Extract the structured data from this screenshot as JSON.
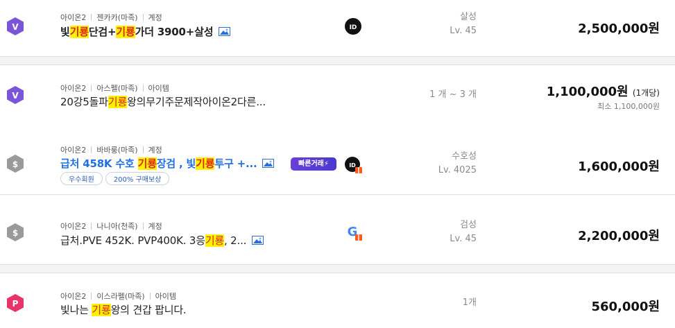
{
  "listings": [
    {
      "grade": "V",
      "grade_color": "#7b55d8",
      "meta": [
        "아이온2",
        "젠카카(마족)",
        "계정"
      ],
      "title_pre": "빛",
      "hl1": "기룡",
      "title_mid": "단검+",
      "hl2": "기룡",
      "title_post": "가더 3900+살성",
      "info_line1": "살성",
      "info_line2": "Lv. 45",
      "price": "2,500,000원",
      "seller_icon": "id-badge-icon"
    },
    {
      "grade": "V",
      "grade_color": "#7b55d8",
      "meta": [
        "아이온2",
        "아스펠(마족)",
        "아이템"
      ],
      "title_pre": "20강5돌파",
      "hl1": "기룡",
      "title_post": "왕의무기주문제작아이온2다른...",
      "info_line1": "1 개 ~ 3 개",
      "price": "1,100,000원",
      "price_unit": "(1개당)",
      "min_price": "최소 1,100,000원"
    },
    {
      "grade": "S",
      "grade_color": "#9a9a9a",
      "meta": [
        "아이온2",
        "바바룽(마족)",
        "계정"
      ],
      "title_pre": "급처 458K 수호 ",
      "hl1": "기룡",
      "title_mid": "장검 , 빛",
      "hl2": "기룡",
      "title_post": "투구 +...",
      "tags": [
        "우수회원",
        "200% 구매보상"
      ],
      "quick_label": "빠른거래",
      "info_line1": "수호성",
      "info_line2": "Lv. 4025",
      "price": "1,600,000원",
      "seller_icon": "id-gift-badge-icon"
    },
    {
      "grade": "S",
      "grade_color": "#9a9a9a",
      "meta": [
        "아이온2",
        "나니아(천족)",
        "계정"
      ],
      "title_pre": "급처.PVE 452K. PVP400K. 3응",
      "hl1": "기룡",
      "title_post": ", 2...",
      "info_line1": "검성",
      "info_line2": "Lv. 45",
      "price": "2,200,000원",
      "seller_icon": "google-gift-badge-icon"
    },
    {
      "grade": "P",
      "grade_color": "#e8336b",
      "meta": [
        "아이온2",
        "이스라펠(마족)",
        "아이템"
      ],
      "title_pre": "빛나는 ",
      "hl1": "기룡",
      "title_post": "왕의 견갑 팝니다.",
      "info_line1": "1개",
      "price": "560,000원"
    }
  ]
}
